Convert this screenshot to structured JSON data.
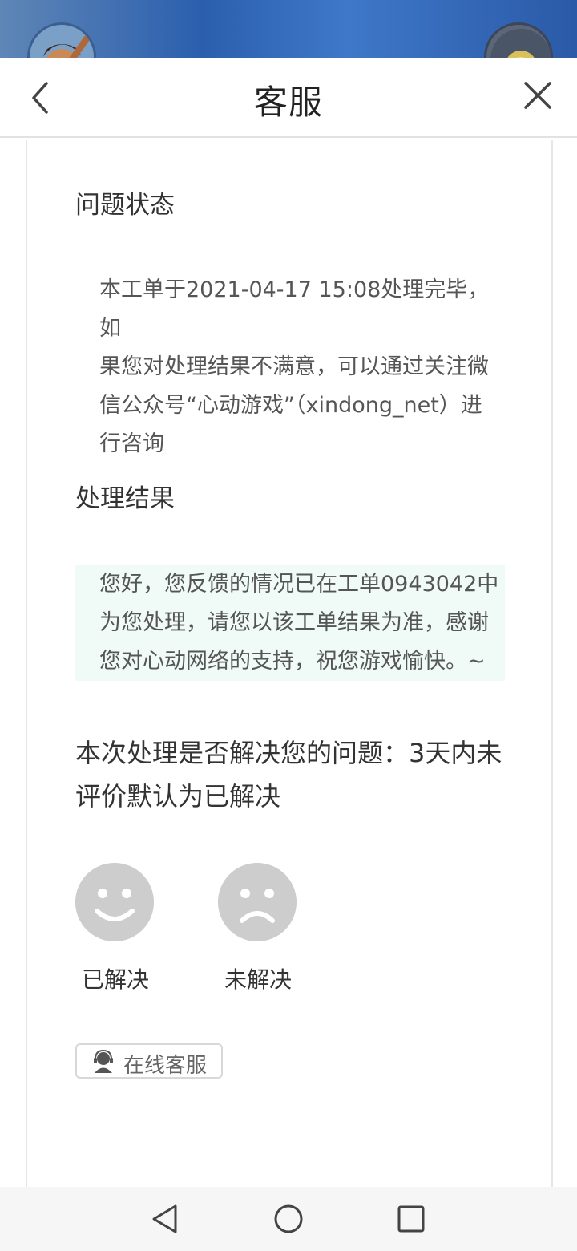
{
  "header": {
    "title": "客服"
  },
  "status": {
    "title": "问题状态",
    "lines": [
      "本工单于2021-04-17 15:08处理完毕，如",
      "果您对处理结果不满意，可以通过关注微",
      "信公众号“心动游戏”（xindong_net）进",
      "行咨询"
    ]
  },
  "result": {
    "title": "处理结果",
    "lines": [
      "您好，您反馈的情况已在工单0943042中",
      "为您处理，请您以该工单结果为准，感谢",
      "您对心动网络的支持，祝您游戏愉快。~"
    ]
  },
  "feedback": {
    "question_lines": [
      "本次处理是否解决您的问题：3天内未",
      "评价默认为已解决"
    ],
    "resolved_label": "已解决",
    "unresolved_label": "未解决"
  },
  "online_service": {
    "label": "在线客服"
  },
  "colors": {
    "result_bg": "#f0faf7",
    "face_gray": "#cdcdcd",
    "text_dark": "#333333"
  },
  "icons": [
    "back-arrow-icon",
    "close-icon",
    "smile-face-icon",
    "sad-face-icon",
    "customer-service-icon",
    "nav-back-icon",
    "nav-home-icon",
    "nav-recents-icon"
  ]
}
